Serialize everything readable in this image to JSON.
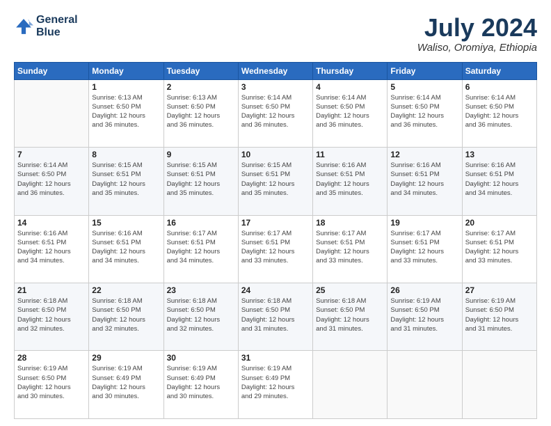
{
  "header": {
    "logo_line1": "General",
    "logo_line2": "Blue",
    "month_year": "July 2024",
    "location": "Waliso, Oromiya, Ethiopia"
  },
  "days_of_week": [
    "Sunday",
    "Monday",
    "Tuesday",
    "Wednesday",
    "Thursday",
    "Friday",
    "Saturday"
  ],
  "weeks": [
    [
      {
        "day": "",
        "info": ""
      },
      {
        "day": "1",
        "info": "Sunrise: 6:13 AM\nSunset: 6:50 PM\nDaylight: 12 hours\nand 36 minutes."
      },
      {
        "day": "2",
        "info": "Sunrise: 6:13 AM\nSunset: 6:50 PM\nDaylight: 12 hours\nand 36 minutes."
      },
      {
        "day": "3",
        "info": "Sunrise: 6:14 AM\nSunset: 6:50 PM\nDaylight: 12 hours\nand 36 minutes."
      },
      {
        "day": "4",
        "info": "Sunrise: 6:14 AM\nSunset: 6:50 PM\nDaylight: 12 hours\nand 36 minutes."
      },
      {
        "day": "5",
        "info": "Sunrise: 6:14 AM\nSunset: 6:50 PM\nDaylight: 12 hours\nand 36 minutes."
      },
      {
        "day": "6",
        "info": "Sunrise: 6:14 AM\nSunset: 6:50 PM\nDaylight: 12 hours\nand 36 minutes."
      }
    ],
    [
      {
        "day": "7",
        "info": "Sunrise: 6:14 AM\nSunset: 6:50 PM\nDaylight: 12 hours\nand 36 minutes."
      },
      {
        "day": "8",
        "info": "Sunrise: 6:15 AM\nSunset: 6:51 PM\nDaylight: 12 hours\nand 35 minutes."
      },
      {
        "day": "9",
        "info": "Sunrise: 6:15 AM\nSunset: 6:51 PM\nDaylight: 12 hours\nand 35 minutes."
      },
      {
        "day": "10",
        "info": "Sunrise: 6:15 AM\nSunset: 6:51 PM\nDaylight: 12 hours\nand 35 minutes."
      },
      {
        "day": "11",
        "info": "Sunrise: 6:16 AM\nSunset: 6:51 PM\nDaylight: 12 hours\nand 35 minutes."
      },
      {
        "day": "12",
        "info": "Sunrise: 6:16 AM\nSunset: 6:51 PM\nDaylight: 12 hours\nand 34 minutes."
      },
      {
        "day": "13",
        "info": "Sunrise: 6:16 AM\nSunset: 6:51 PM\nDaylight: 12 hours\nand 34 minutes."
      }
    ],
    [
      {
        "day": "14",
        "info": "Sunrise: 6:16 AM\nSunset: 6:51 PM\nDaylight: 12 hours\nand 34 minutes."
      },
      {
        "day": "15",
        "info": "Sunrise: 6:16 AM\nSunset: 6:51 PM\nDaylight: 12 hours\nand 34 minutes."
      },
      {
        "day": "16",
        "info": "Sunrise: 6:17 AM\nSunset: 6:51 PM\nDaylight: 12 hours\nand 34 minutes."
      },
      {
        "day": "17",
        "info": "Sunrise: 6:17 AM\nSunset: 6:51 PM\nDaylight: 12 hours\nand 33 minutes."
      },
      {
        "day": "18",
        "info": "Sunrise: 6:17 AM\nSunset: 6:51 PM\nDaylight: 12 hours\nand 33 minutes."
      },
      {
        "day": "19",
        "info": "Sunrise: 6:17 AM\nSunset: 6:51 PM\nDaylight: 12 hours\nand 33 minutes."
      },
      {
        "day": "20",
        "info": "Sunrise: 6:17 AM\nSunset: 6:51 PM\nDaylight: 12 hours\nand 33 minutes."
      }
    ],
    [
      {
        "day": "21",
        "info": "Sunrise: 6:18 AM\nSunset: 6:50 PM\nDaylight: 12 hours\nand 32 minutes."
      },
      {
        "day": "22",
        "info": "Sunrise: 6:18 AM\nSunset: 6:50 PM\nDaylight: 12 hours\nand 32 minutes."
      },
      {
        "day": "23",
        "info": "Sunrise: 6:18 AM\nSunset: 6:50 PM\nDaylight: 12 hours\nand 32 minutes."
      },
      {
        "day": "24",
        "info": "Sunrise: 6:18 AM\nSunset: 6:50 PM\nDaylight: 12 hours\nand 31 minutes."
      },
      {
        "day": "25",
        "info": "Sunrise: 6:18 AM\nSunset: 6:50 PM\nDaylight: 12 hours\nand 31 minutes."
      },
      {
        "day": "26",
        "info": "Sunrise: 6:19 AM\nSunset: 6:50 PM\nDaylight: 12 hours\nand 31 minutes."
      },
      {
        "day": "27",
        "info": "Sunrise: 6:19 AM\nSunset: 6:50 PM\nDaylight: 12 hours\nand 31 minutes."
      }
    ],
    [
      {
        "day": "28",
        "info": "Sunrise: 6:19 AM\nSunset: 6:50 PM\nDaylight: 12 hours\nand 30 minutes."
      },
      {
        "day": "29",
        "info": "Sunrise: 6:19 AM\nSunset: 6:49 PM\nDaylight: 12 hours\nand 30 minutes."
      },
      {
        "day": "30",
        "info": "Sunrise: 6:19 AM\nSunset: 6:49 PM\nDaylight: 12 hours\nand 30 minutes."
      },
      {
        "day": "31",
        "info": "Sunrise: 6:19 AM\nSunset: 6:49 PM\nDaylight: 12 hours\nand 29 minutes."
      },
      {
        "day": "",
        "info": ""
      },
      {
        "day": "",
        "info": ""
      },
      {
        "day": "",
        "info": ""
      }
    ]
  ]
}
